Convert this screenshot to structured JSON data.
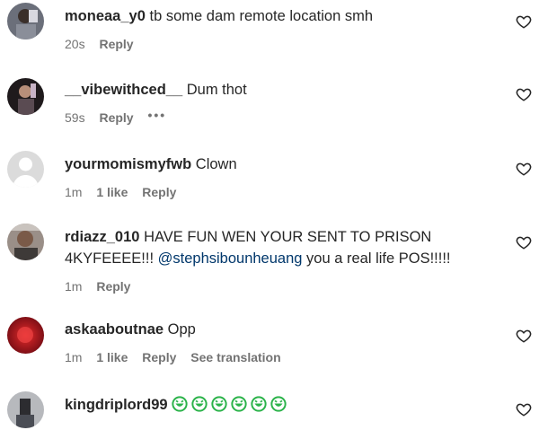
{
  "comments": [
    {
      "username": "moneaa_y0",
      "text": "tb some dam remote location smh",
      "time": "20s",
      "likes": "",
      "reply": "Reply"
    },
    {
      "username": "__vibewithced__",
      "text": "Dum thot",
      "time": "59s",
      "likes": "",
      "reply": "Reply",
      "more": "•••"
    },
    {
      "username": "yourmomismyfwb",
      "text": "Clown",
      "time": "1m",
      "likes": "1 like",
      "reply": "Reply"
    },
    {
      "username": "rdiazz_010",
      "text_before": "HAVE FUN WEN YOUR SENT TO PRISON 4KYFEEEE!!!",
      "mention": "@stephsibounheuang",
      "text_after": "you a real life POS!!!!!",
      "time": "1m",
      "likes": "",
      "reply": "Reply"
    },
    {
      "username": "askaaboutnae",
      "text": "Opp",
      "time": "1m",
      "likes": "1 like",
      "reply": "Reply",
      "translate": "See translation"
    },
    {
      "username": "kingdriplord99",
      "emoji_icon": "green-laughing-emoji",
      "emoji_count": 6
    }
  ],
  "colors": {
    "text": "#262626",
    "meta": "#737373",
    "mention": "#00376b",
    "emoji": "#2bb34a"
  }
}
